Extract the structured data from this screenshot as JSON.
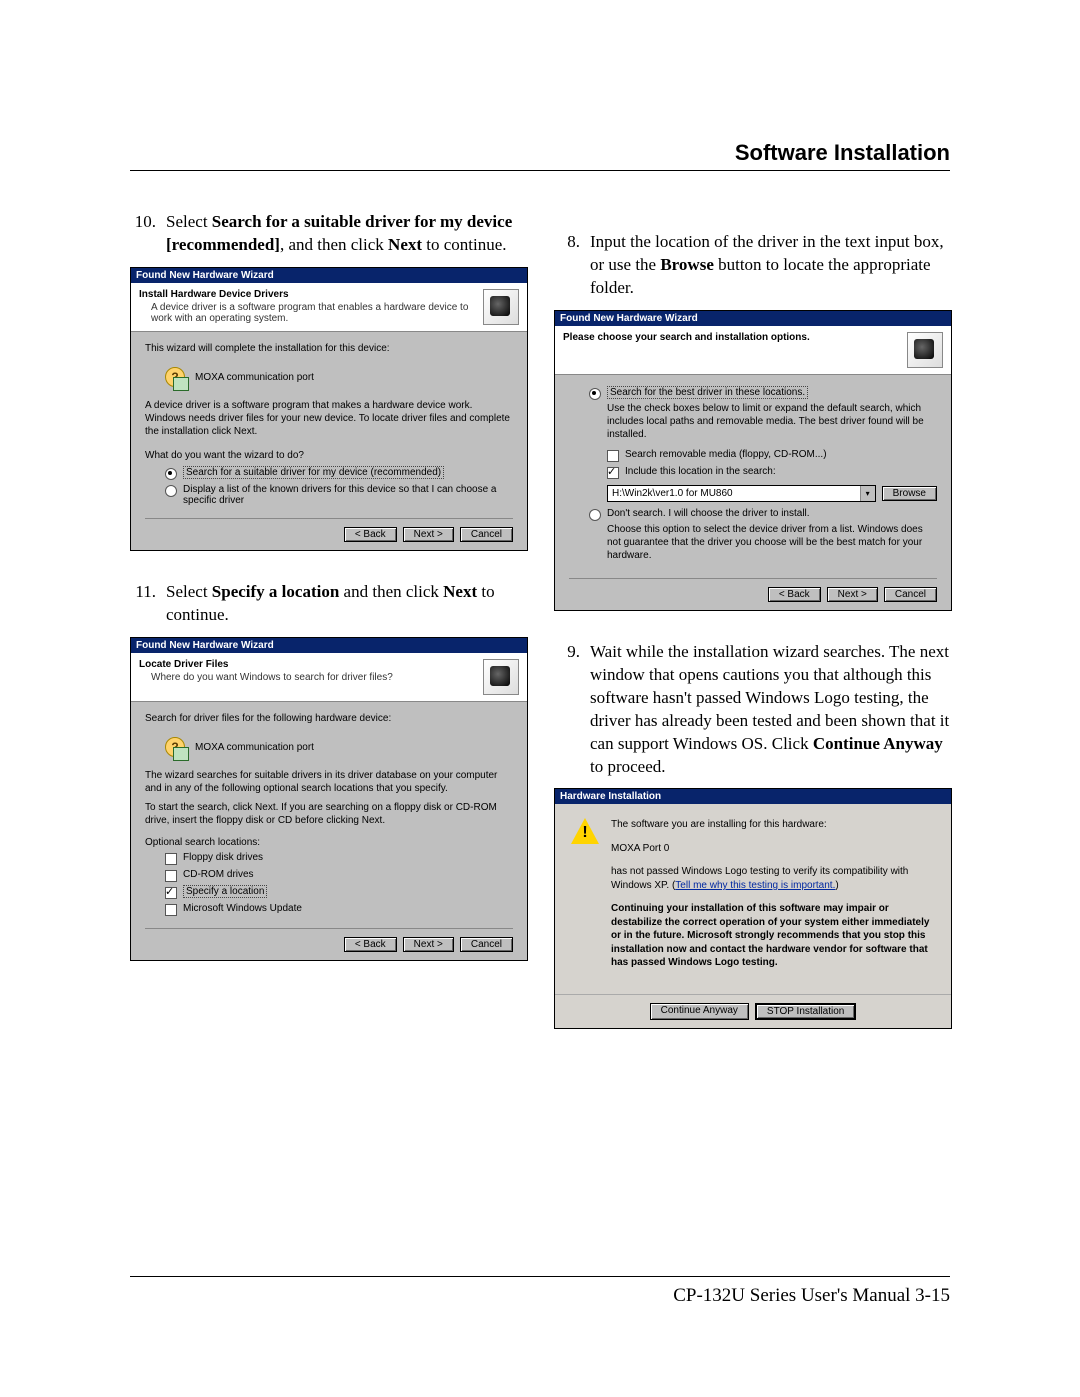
{
  "header": {
    "chapter": "Software Installation"
  },
  "steps": {
    "s10": {
      "num": "10.",
      "pre": "Select ",
      "bold1": "Search for a suitable driver for my device [recommended]",
      "mid": ", and then click ",
      "bold2": "Next",
      "post": " to continue."
    },
    "s11": {
      "num": "11.",
      "pre": "Select ",
      "bold1": "Specify a location",
      "mid": " and then click ",
      "bold2": "Next",
      "post": " to continue."
    },
    "s8": {
      "num": "8.",
      "text_a": "Input the location of the driver in the text input box, or use the ",
      "bold": "Browse",
      "text_b": " button to locate the appropriate folder."
    },
    "s9": {
      "num": "9.",
      "text_a": "Wait while the installation wizard searches. The next window that opens cautions you that although this software hasn't passed Windows Logo testing, the driver has already been tested and been shown that it can support Windows OS. Click ",
      "bold": "Continue Anyway",
      "text_b": " to proceed."
    }
  },
  "wiz1": {
    "title": "Found New Hardware Wizard",
    "h1": "Install Hardware Device Drivers",
    "h2": "A device driver is a software program that enables a hardware device to work with an operating system.",
    "intro": "This wizard will complete the installation for this device:",
    "device": "MOXA communication port",
    "para2": "A device driver is a software program that makes a hardware device work. Windows needs driver files for your new device. To locate driver files and complete the installation click Next.",
    "question": "What do you want the wizard to do?",
    "opt1": "Search for a suitable driver for my device (recommended)",
    "opt2": "Display a list of the known drivers for this device so that I can choose a specific driver",
    "back": "< Back",
    "next": "Next >",
    "cancel": "Cancel"
  },
  "wiz2": {
    "title": "Found New Hardware Wizard",
    "h1": "Locate Driver Files",
    "h2": "Where do you want Windows to search for driver files?",
    "intro": "Search for driver files for the following hardware device:",
    "device": "MOXA communication port",
    "para2": "The wizard searches for suitable drivers in its driver database on your computer and in any of the following optional search locations that you specify.",
    "para3": "To start the search, click Next. If you are searching on a floppy disk or CD-ROM drive, insert the floppy disk or CD before clicking Next.",
    "optshdr": "Optional search locations:",
    "chk1": "Floppy disk drives",
    "chk2": "CD-ROM drives",
    "chk3": "Specify a location",
    "chk4": "Microsoft Windows Update",
    "back": "< Back",
    "next": "Next >",
    "cancel": "Cancel"
  },
  "wiz3": {
    "title": "Found New Hardware Wizard",
    "h1": "Please choose your search and installation options.",
    "opt1": "Search for the best driver in these locations.",
    "opt1_desc": "Use the check boxes below to limit or expand the default search, which includes local paths and removable media. The best driver found will be installed.",
    "chk1": "Search removable media (floppy, CD-ROM...)",
    "chk2": "Include this location in the search:",
    "path": "H:\\Win2k\\ver1.0 for MU860",
    "browse": "Browse",
    "opt2": "Don't search. I will choose the driver to install.",
    "opt2_desc": "Choose this option to select the device driver from a list. Windows does not guarantee that the driver you choose will be the best match for your hardware.",
    "back": "< Back",
    "next": "Next >",
    "cancel": "Cancel"
  },
  "warn": {
    "title": "Hardware Installation",
    "p1a": "The software you are installing for this hardware:",
    "p1b": "MOXA Port 0",
    "p2": "has not passed Windows Logo testing to verify its compatibility with Windows XP. (",
    "link": "Tell me why this testing is important.",
    "p2b": ")",
    "p3": "Continuing your installation of this software may impair or destabilize the correct operation of your system either immediately or in the future. Microsoft strongly recommends that you stop this installation now and contact the hardware vendor for software that has passed Windows Logo testing.",
    "btn_continue": "Continue Anyway",
    "btn_stop": "STOP Installation"
  },
  "footer": {
    "text": "CP-132U Series User's Manual 3-15"
  }
}
